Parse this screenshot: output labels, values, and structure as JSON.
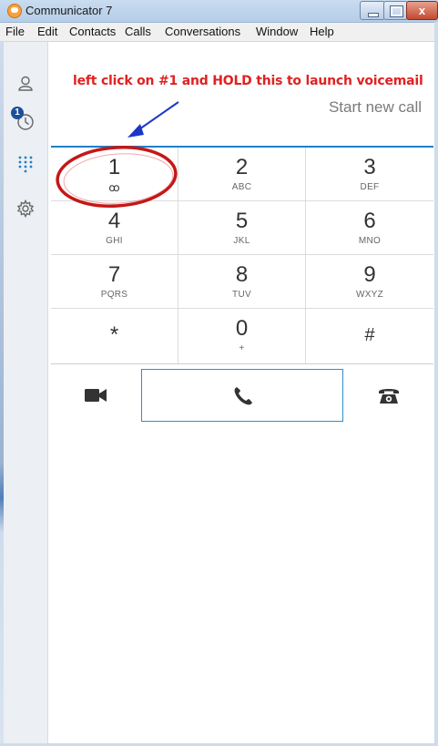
{
  "window": {
    "title": "Communicator 7",
    "close_glyph": "x"
  },
  "menu": {
    "items": [
      "File",
      "Edit",
      "Contacts",
      "Calls",
      "Conversations",
      "Window",
      "Help"
    ]
  },
  "rail": {
    "icons": [
      "contacts-icon",
      "recent-calls-icon",
      "dialpad-icon",
      "settings-gear-icon"
    ],
    "recent_badge": "1"
  },
  "annotation": {
    "text": "left click on #1 and HOLD this to launch voicemail",
    "color": "#e02121"
  },
  "call_header": {
    "start_new_call": "Start new call"
  },
  "dialpad": {
    "keys": [
      {
        "digit": "1",
        "letters": "",
        "glyph": "ꝏ"
      },
      {
        "digit": "2",
        "letters": "ABC"
      },
      {
        "digit": "3",
        "letters": "DEF"
      },
      {
        "digit": "4",
        "letters": "GHI"
      },
      {
        "digit": "5",
        "letters": "JKL"
      },
      {
        "digit": "6",
        "letters": "MNO"
      },
      {
        "digit": "7",
        "letters": "PQRS"
      },
      {
        "digit": "8",
        "letters": "TUV"
      },
      {
        "digit": "9",
        "letters": "WXYZ"
      },
      {
        "digit": "*",
        "letters": ""
      },
      {
        "digit": "0",
        "letters": "+"
      },
      {
        "digit": "#",
        "letters": ""
      }
    ]
  },
  "actions": {
    "video_icon": "video-camera-icon",
    "call_icon": "phone-handset-icon",
    "deskphone_icon": "desk-phone-icon"
  },
  "colors": {
    "accent": "#1f80c8",
    "annotation_red": "#e02121",
    "badge": "#1c4f9a"
  }
}
